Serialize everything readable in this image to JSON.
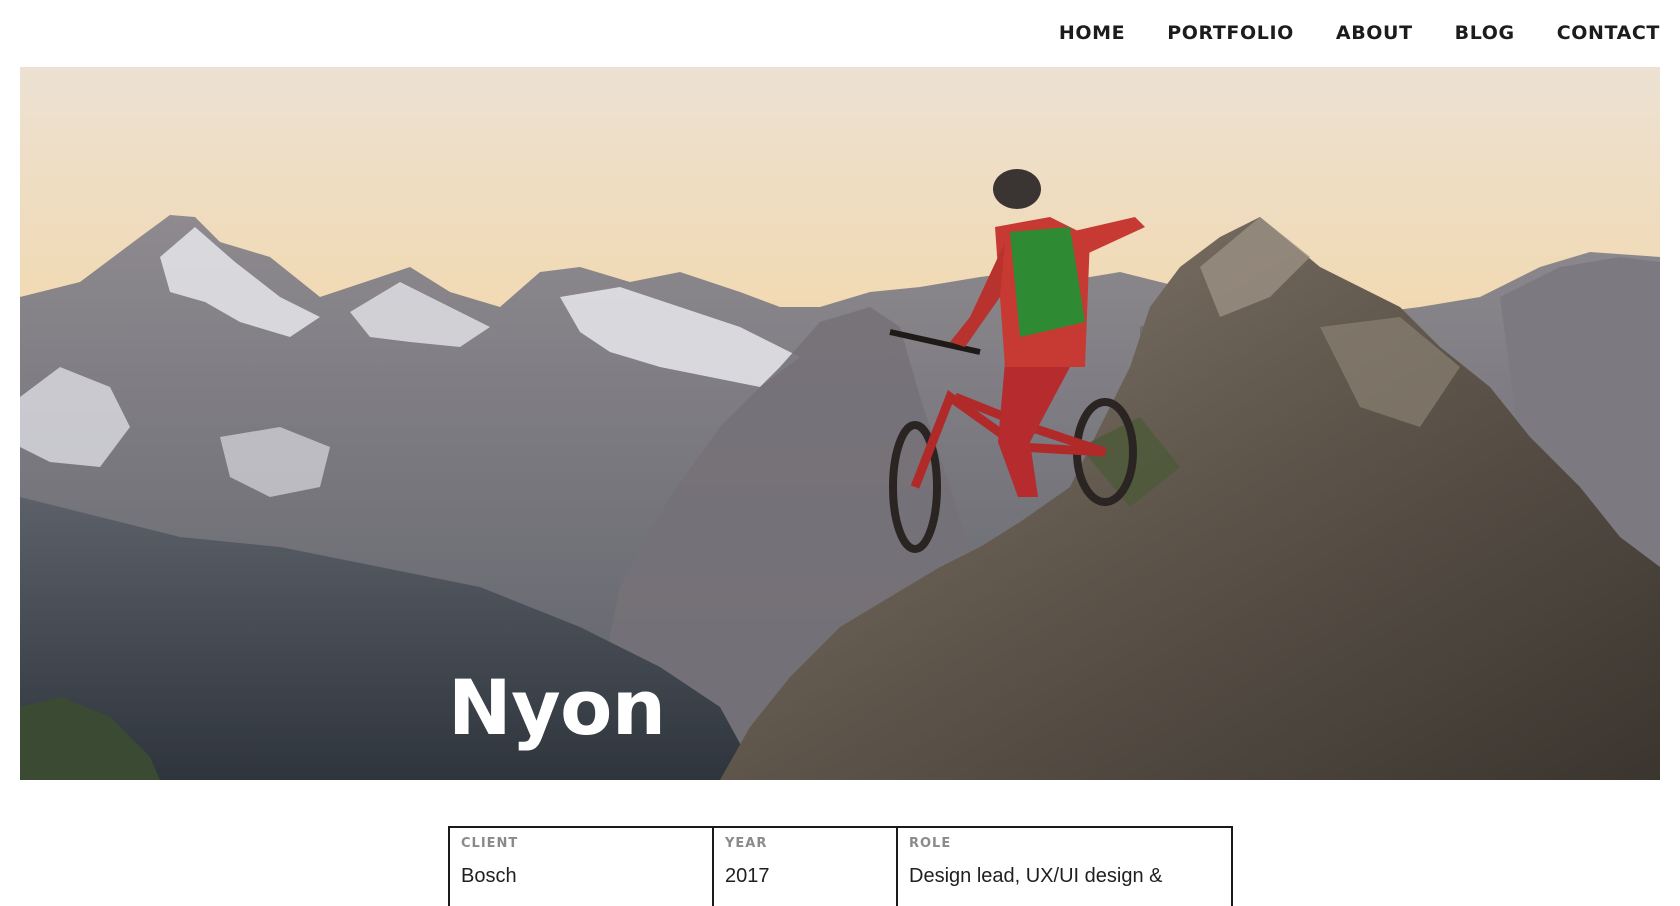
{
  "nav": {
    "items": [
      {
        "label": "HOME"
      },
      {
        "label": "PORTFOLIO"
      },
      {
        "label": "ABOUT"
      },
      {
        "label": "BLOG"
      },
      {
        "label": "CONTACT"
      }
    ]
  },
  "hero": {
    "title": "Nyon",
    "image_icon": "mountain-biker-photo"
  },
  "details": {
    "client": {
      "label": "CLIENT",
      "value": "Bosch"
    },
    "year": {
      "label": "YEAR",
      "value": "2017"
    },
    "role": {
      "label": "ROLE",
      "value": "Design lead, UX/UI design &"
    }
  },
  "colors": {
    "text_dark": "#1c1c1c",
    "label_gray": "#8a8a8a",
    "border": "#1a1a1a",
    "hero_title": "#ffffff"
  }
}
